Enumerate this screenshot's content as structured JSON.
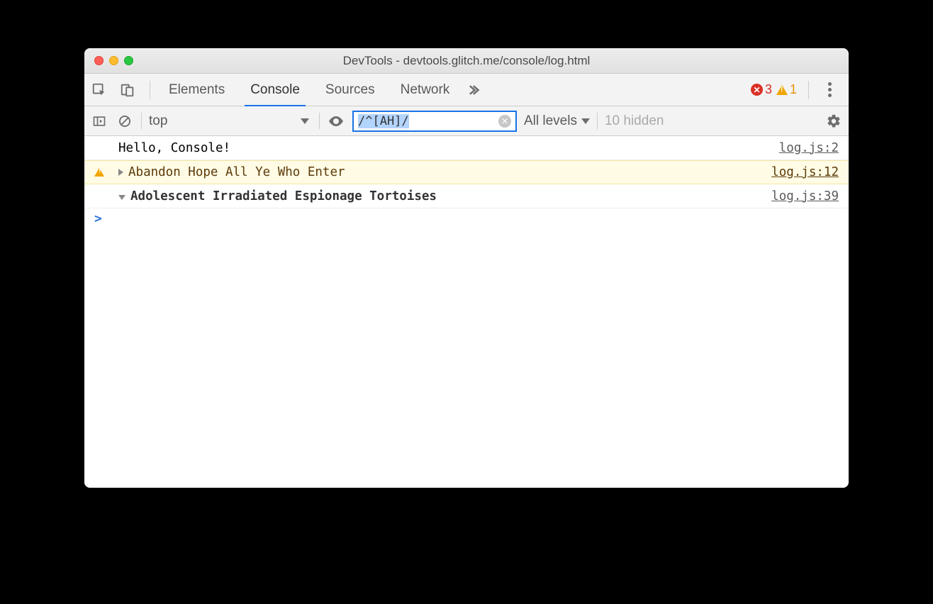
{
  "window": {
    "title": "DevTools - devtools.glitch.me/console/log.html"
  },
  "tabs": {
    "items": [
      "Elements",
      "Console",
      "Sources",
      "Network"
    ],
    "active": "Console"
  },
  "badges": {
    "error_count": "3",
    "warning_count": "1"
  },
  "toolbar": {
    "context": "top",
    "filter_value": "/^[AH]/",
    "levels_label": "All levels",
    "hidden_label": "10 hidden"
  },
  "logs": [
    {
      "type": "log",
      "message": "Hello, Console!",
      "source": "log.js:2",
      "disclose": "none"
    },
    {
      "type": "warn",
      "message": "Abandon Hope All Ye Who Enter",
      "source": "log.js:12",
      "disclose": "right"
    },
    {
      "type": "group",
      "message": "Adolescent Irradiated Espionage Tortoises",
      "source": "log.js:39",
      "disclose": "down"
    }
  ],
  "prompt": ">"
}
